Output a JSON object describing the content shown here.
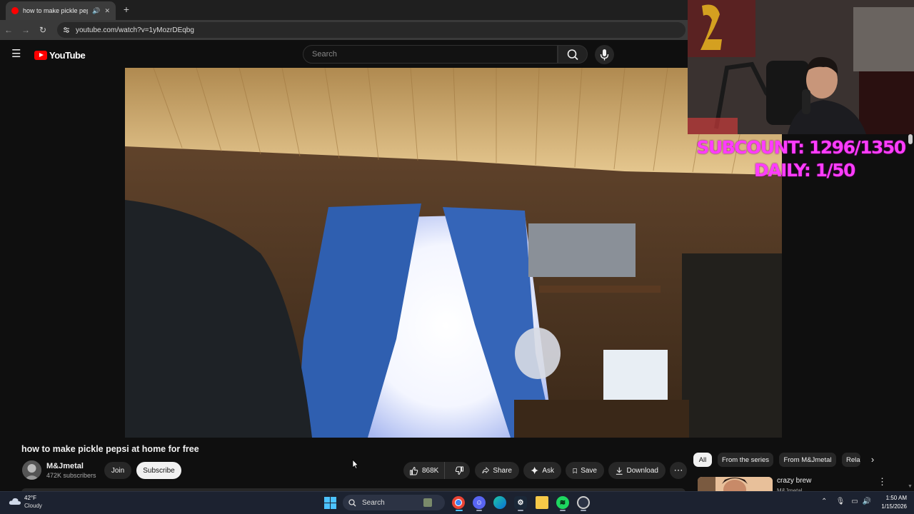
{
  "browser": {
    "tab_title": "how to make pickle pepsi at home for free",
    "address": "youtube.com/watch?v=1yMozrDEqbg"
  },
  "youtube": {
    "logo_text": "YouTube",
    "search_placeholder": "Search"
  },
  "overlay": {
    "subcount": "SUBCOUNT: 1296/1350",
    "daily": "DAILY: 1/50",
    "text_color": "#ff3cff"
  },
  "video": {
    "title": "how to make pickle pepsi at home for free",
    "channel_name": "M&Jmetal",
    "channel_subs": "472K subscribers",
    "join_label": "Join",
    "subscribe_label": "Subscribe",
    "likes": "868K",
    "share_label": "Share",
    "ask_label": "Ask",
    "save_label": "Save",
    "download_label": "Download"
  },
  "sidebar": {
    "chips": [
      "All",
      "From the series",
      "From M&Jmetal",
      "Rela"
    ],
    "rec_title": "crazy brew",
    "rec_channel": "M&Jmetal"
  },
  "taskbar": {
    "temp": "42°F",
    "weather": "Cloudy",
    "search_label": "Search",
    "time": "1:50 AM",
    "date": "1/15/2026"
  },
  "colors": {
    "youtube_red": "#ff0000",
    "overlay_magenta": "#ff3cff"
  }
}
